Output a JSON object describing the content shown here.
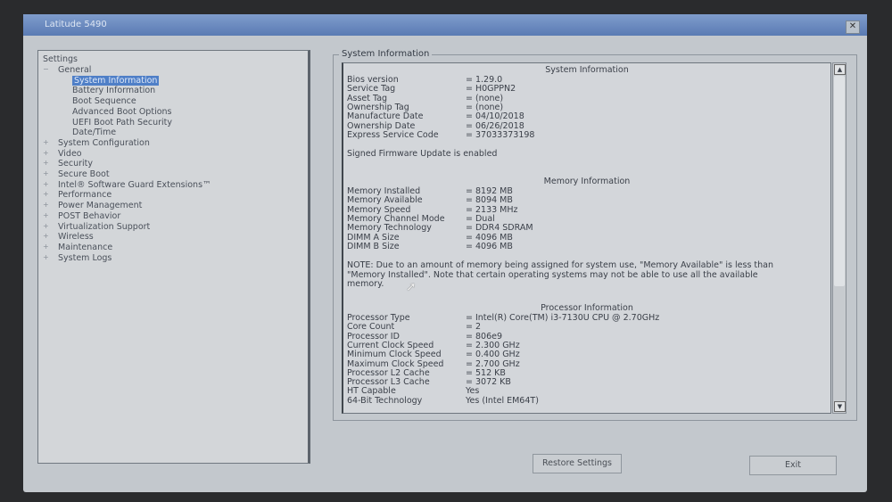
{
  "window": {
    "title": "Latitude 5490",
    "close_label": "✕"
  },
  "tree": {
    "root": "Settings",
    "items": [
      {
        "label": "General",
        "level": 0,
        "expanded": true
      },
      {
        "label": "System Information",
        "level": 1,
        "selected": true
      },
      {
        "label": "Battery Information",
        "level": 1
      },
      {
        "label": "Boot Sequence",
        "level": 1
      },
      {
        "label": "Advanced Boot Options",
        "level": 1
      },
      {
        "label": "UEFI Boot Path Security",
        "level": 1
      },
      {
        "label": "Date/Time",
        "level": 1
      },
      {
        "label": "System Configuration",
        "level": 0
      },
      {
        "label": "Video",
        "level": 0
      },
      {
        "label": "Security",
        "level": 0
      },
      {
        "label": "Secure Boot",
        "level": 0
      },
      {
        "label": "Intel® Software Guard Extensions™",
        "level": 0
      },
      {
        "label": "Performance",
        "level": 0
      },
      {
        "label": "Power Management",
        "level": 0
      },
      {
        "label": "POST Behavior",
        "level": 0
      },
      {
        "label": "Virtualization Support",
        "level": 0
      },
      {
        "label": "Wireless",
        "level": 0
      },
      {
        "label": "Maintenance",
        "level": 0
      },
      {
        "label": "System Logs",
        "level": 0
      }
    ]
  },
  "panel": {
    "group_label": "System Information",
    "system_header": "System Information",
    "system": [
      [
        "Bios version",
        "= 1.29.0"
      ],
      [
        "Service Tag",
        "= H0GPPN2"
      ],
      [
        "Asset Tag",
        "= (none)"
      ],
      [
        "Ownership Tag",
        "= (none)"
      ],
      [
        "Manufacture Date",
        "= 04/10/2018"
      ],
      [
        "Ownership Date",
        "= 06/26/2018"
      ],
      [
        "Express Service Code",
        "= 37033373198"
      ]
    ],
    "firmware_note": "Signed Firmware Update is enabled",
    "memory_header": "Memory Information",
    "memory": [
      [
        "Memory Installed",
        "= 8192 MB"
      ],
      [
        "Memory Available",
        "= 8094 MB"
      ],
      [
        "Memory Speed",
        "= 2133 MHz"
      ],
      [
        "Memory Channel Mode",
        "= Dual"
      ],
      [
        "Memory Technology",
        "= DDR4 SDRAM"
      ],
      [
        "DIMM A Size",
        "= 4096 MB"
      ],
      [
        "DIMM B Size",
        "= 4096 MB"
      ]
    ],
    "memory_note": "NOTE: Due to an amount of memory being assigned for system use, \"Memory Available\" is less than \"Memory Installed\". Note that certain operating systems may not be able to use all the available memory.",
    "processor_header": "Processor Information",
    "processor": [
      [
        "Processor Type",
        "= Intel(R) Core(TM) i3-7130U CPU @ 2.70GHz"
      ],
      [
        "Core Count",
        "= 2"
      ],
      [
        "Processor ID",
        "= 806e9"
      ],
      [
        "Current Clock Speed",
        "= 2.300 GHz"
      ],
      [
        "Minimum Clock Speed",
        "= 0.400 GHz"
      ],
      [
        "Maximum Clock Speed",
        "= 2.700 GHz"
      ],
      [
        "Processor L2 Cache",
        "= 512 KB"
      ],
      [
        "Processor L3 Cache",
        "= 3072 KB"
      ],
      [
        "HT Capable",
        "Yes"
      ],
      [
        "64-Bit Technology",
        "Yes (Intel EM64T)"
      ]
    ]
  },
  "buttons": {
    "restore": "Restore Settings",
    "exit": "Exit"
  }
}
